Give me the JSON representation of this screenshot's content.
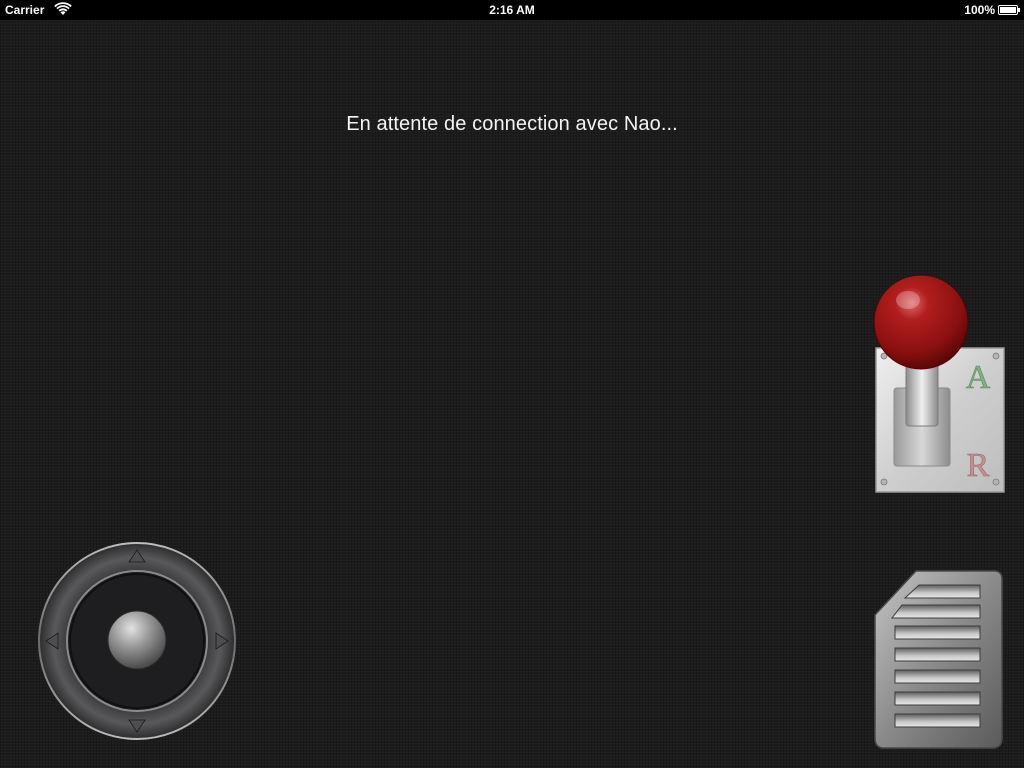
{
  "status_bar": {
    "carrier": "Carrier",
    "time": "2:16 AM",
    "battery_percent": "100%",
    "battery_level": 1.0,
    "wifi_icon": "wifi-icon",
    "battery_icon": "battery-icon"
  },
  "main": {
    "connection_status": "En attente de connection avec Nao..."
  },
  "gear_shifter": {
    "forward_label": "A",
    "reverse_label": "R",
    "knob_color": "#a01818",
    "forward_color": "#7fae82",
    "reverse_color": "#c48f8f"
  },
  "joystick": {
    "up_icon": "arrow-up-icon",
    "down_icon": "arrow-down-icon",
    "left_icon": "arrow-left-icon",
    "right_icon": "arrow-right-icon",
    "knob_icon": "joystick-knob-icon"
  },
  "pedal": {
    "icon": "pedal-icon"
  },
  "colors": {
    "background": "#1c1c1d",
    "status_bar": "#000000",
    "text": "#f4f4f4"
  }
}
